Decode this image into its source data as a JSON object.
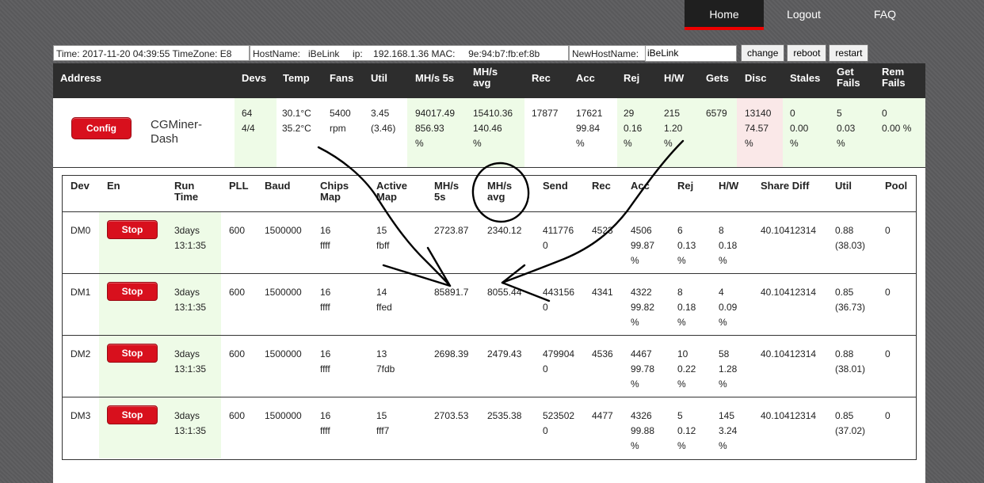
{
  "nav": {
    "home": "Home",
    "logout": "Logout",
    "faq": "FAQ"
  },
  "info": {
    "time": "Time: 2017-11-20 04:39:55 TimeZone: E8",
    "host": "HostName:   iBeLink     ip:    192.168.1.36 MAC:     9e:94:b7:fb:ef:8b",
    "new_host_label": "NewHostName:",
    "new_host_value": "iBeLink",
    "change": "change",
    "reboot": "reboot",
    "restart": "restart"
  },
  "summary": {
    "headers": [
      "Address",
      "Devs",
      "Temp",
      "Fans",
      "Util",
      "MH/s 5s",
      "MH/s\navg",
      "Rec",
      "Acc",
      "Rej",
      "H/W",
      "Gets",
      "Disc",
      "Stales",
      "Get\nFails",
      "Rem\nFails"
    ],
    "config_label": "Config",
    "address_name": "CGMiner-\nDash",
    "cells": [
      "64\n4/4",
      "30.1°C\n35.2°C",
      "5400\nrpm",
      "3.45\n(3.46)",
      "94017.49\n856.93\n%",
      "15410.36\n140.46\n%",
      "17877",
      "17621\n99.84\n%",
      "29\n0.16\n%",
      "215\n1.20\n%",
      "6579",
      "13140\n74.57\n%",
      "0\n0.00\n%",
      "5\n0.03\n%",
      "0\n0.00 %"
    ]
  },
  "devices": {
    "headers": [
      "Dev",
      "En",
      "Run\nTime",
      "PLL",
      "Baud",
      "Chips\nMap",
      "Active\nMap",
      "MH/s\n5s",
      "MH/s\navg",
      "Send",
      "Rec",
      "Acc",
      "Rej",
      "H/W",
      "Share Diff",
      "Util",
      "Pool"
    ],
    "stop_label": "Stop",
    "rows": [
      [
        "DM0",
        "3days\n13:1:35",
        "600",
        "1500000",
        "16\nffff",
        "15\nfbff",
        "2723.87",
        "2340.12",
        "411776\n0",
        "4523",
        "4506\n99.87\n%",
        "6\n0.13\n%",
        "8\n0.18\n%",
        "40.10412314",
        "0.88\n(38.03)",
        "0"
      ],
      [
        "DM1",
        "3days\n13:1:35",
        "600",
        "1500000",
        "16\nffff",
        "14\nffed",
        "85891.7",
        "8055.44",
        "443156\n0",
        "4341",
        "4322\n99.82\n%",
        "8\n0.18\n%",
        "4\n0.09\n%",
        "40.10412314",
        "0.85\n(36.73)",
        "0"
      ],
      [
        "DM2",
        "3days\n13:1:35",
        "600",
        "1500000",
        "16\nffff",
        "13\n7fdb",
        "2698.39",
        "2479.43",
        "479904\n0",
        "4536",
        "4467\n99.78\n%",
        "10\n0.22\n%",
        "58\n1.28\n%",
        "40.10412314",
        "0.88\n(38.01)",
        "0"
      ],
      [
        "DM3",
        "3days\n13:1:35",
        "600",
        "1500000",
        "16\nffff",
        "15\nfff7",
        "2703.53",
        "2535.38",
        "523502\n0",
        "4477",
        "4326\n99.88\n%",
        "5\n0.12\n%",
        "145\n3.24\n%",
        "40.10412314",
        "0.85\n(37.02)",
        "0"
      ]
    ]
  },
  "colors": {
    "accent": "#e00000",
    "button_red": "#d8101d",
    "green_cell": "#eefbe7",
    "pink_cell": "#fae8e8",
    "header_dark": "#2d2d2d"
  }
}
